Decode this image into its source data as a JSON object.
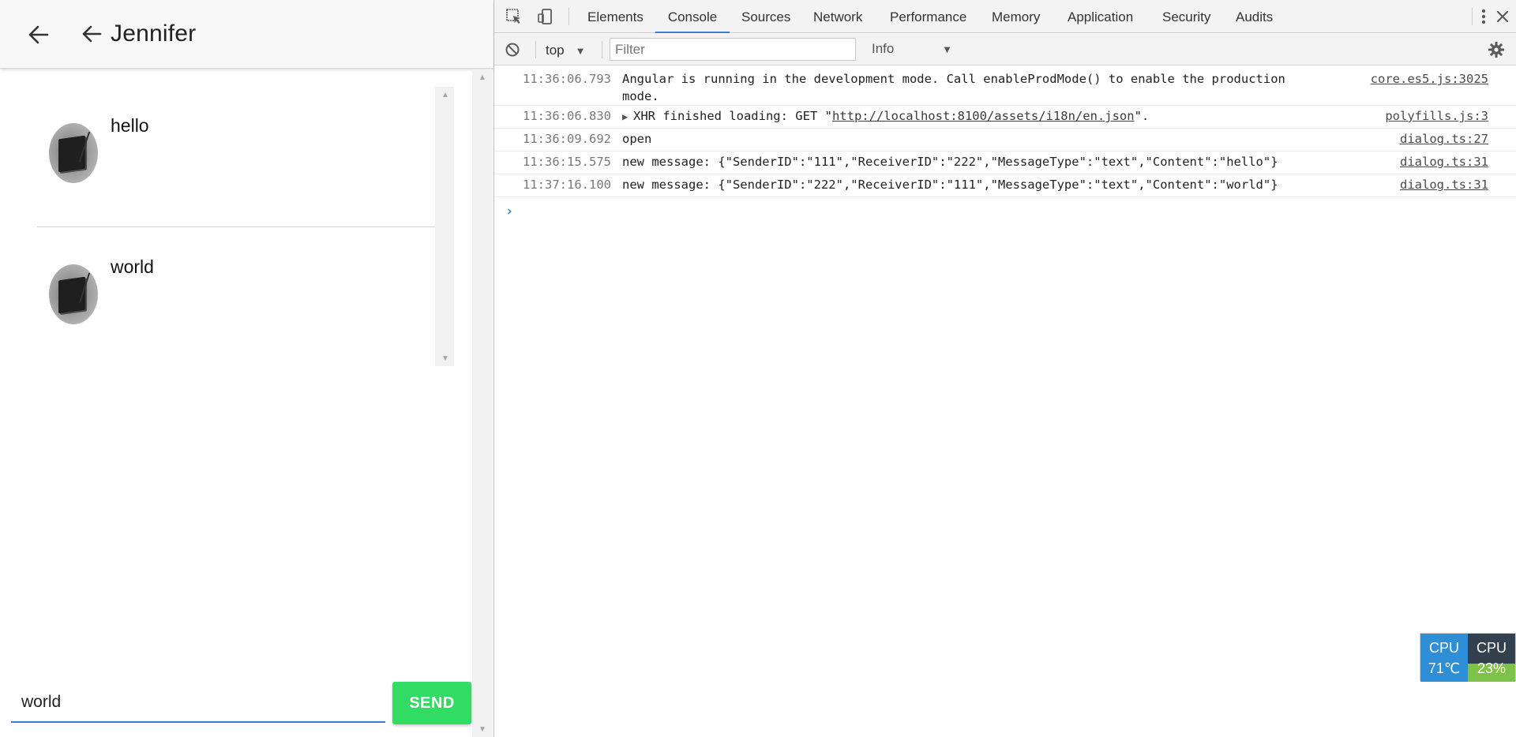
{
  "app": {
    "title": "Jennifer",
    "messages": [
      {
        "text": "hello"
      },
      {
        "text": "world"
      }
    ],
    "compose": {
      "value": "world",
      "send_label": "SEND"
    }
  },
  "devtools": {
    "tabs": [
      "Elements",
      "Console",
      "Sources",
      "Network",
      "Performance",
      "Memory",
      "Application",
      "Security",
      "Audits"
    ],
    "active_tab": "Console",
    "context": "top",
    "filter_placeholder": "Filter",
    "level": "Info",
    "rows": [
      {
        "time": "11:36:06.793",
        "message": "Angular is running in the development mode. Call enableProdMode() to enable the production\nmode.",
        "source": "core.es5.js:3025"
      },
      {
        "time": "11:36:06.830",
        "prefix": "XHR finished loading: GET \"",
        "link": "http://localhost:8100/assets/i18n/en.json",
        "suffix": "\".",
        "source": "polyfills.js:3"
      },
      {
        "time": "11:36:09.692",
        "message": "open",
        "source": "dialog.ts:27"
      },
      {
        "time": "11:36:15.575",
        "message": "new message: {\"SenderID\":\"111\",\"ReceiverID\":\"222\",\"MessageType\":\"text\",\"Content\":\"hello\"}",
        "source": "dialog.ts:31"
      },
      {
        "time": "11:37:16.100",
        "message": "new message: {\"SenderID\":\"222\",\"ReceiverID\":\"111\",\"MessageType\":\"text\",\"Content\":\"world\"}",
        "source": "dialog.ts:31"
      }
    ]
  },
  "cpu": {
    "label1": "CPU",
    "temp": "71℃",
    "label2": "CPU",
    "load": "23%"
  },
  "colors": {
    "send": "#32db64",
    "accent": "#3879d9",
    "cpu_temp": "#2e8fd6",
    "cpu_load": "#7fc24a"
  },
  "icons": [
    "back-arrow-icon",
    "inspect-icon",
    "device-toolbar-icon",
    "clear-console-icon",
    "more-vert-icon",
    "close-icon",
    "settings-gear-icon",
    "expand-triangle-icon",
    "prompt-chevron-icon"
  ]
}
